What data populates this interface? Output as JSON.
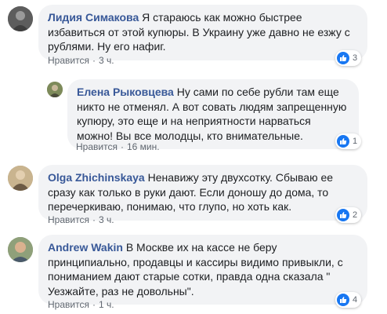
{
  "colors": {
    "author": "#385898",
    "bubble": "#f2f3f5",
    "like_badge": "#1877f2",
    "meta": "#606770"
  },
  "comments": [
    {
      "author": "Лидия Симакова",
      "text": "Я стараюсь как можно быстрее избавиться от этой купюры. В Украину уже давно не езжу с рублями. Ну его нафиг.",
      "like_label": "Нравится",
      "time": "3 ч.",
      "reaction_count": "3",
      "reaction_icon": "thumbs-up-icon"
    },
    {
      "author": "Елена Рыковцева",
      "text": "Ну сами по себе рубли там еще никто не отменял. А вот совать людям запрещенную купюру, это еще и на неприятности нарваться можно! Вы все молодцы, кто внимательные.",
      "like_label": "Нравится",
      "time": "16 мин.",
      "reaction_count": "1",
      "reaction_icon": "thumbs-up-icon"
    },
    {
      "author": "Olga Zhichinskaya",
      "text": "Ненавижу эту двухсотку. Сбываю ее сразу как только в руки дают. Если доношу до дома, то перечеркиваю, понимаю, что глупо, но хоть как.",
      "like_label": "Нравится",
      "time": "3 ч.",
      "reaction_count": "2",
      "reaction_icon": "thumbs-up-icon"
    },
    {
      "author": "Andrew Wakin",
      "text": "В Москве их на кассе не беру принципиально, продавцы и кассиры видимо привыкли, с пониманием дают старые сотки, правда одна сказала \" Уезжайте, раз не довольны\".",
      "like_label": "Нравится",
      "time": "1 ч.",
      "reaction_count": "4",
      "reaction_icon": "thumbs-up-icon"
    }
  ]
}
